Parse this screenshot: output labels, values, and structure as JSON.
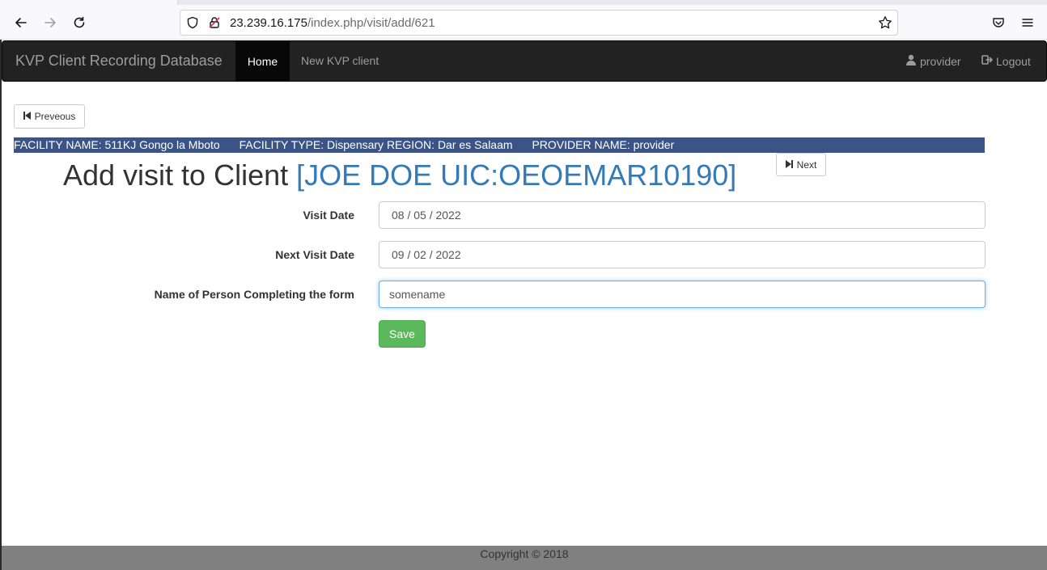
{
  "browser": {
    "url_host": "23.239.16.175",
    "url_path": "/index.php/visit/add/621"
  },
  "navbar": {
    "brand": "KVP Client Recording Database",
    "items": [
      {
        "label": "Home",
        "active": true
      },
      {
        "label": "New KVP client",
        "active": false
      }
    ],
    "user_label": "provider",
    "logout_label": "Logout"
  },
  "pager": {
    "previous_label": "Preveous",
    "next_label": "Next"
  },
  "facility": {
    "name": "FACILITY NAME: 511KJ Gongo la Mboto",
    "type_region": "FACILITY TYPE: Dispensary REGION: Dar es Salaam",
    "provider": "PROVIDER NAME: provider"
  },
  "title": {
    "prefix": "Add visit to Client",
    "client": "[JOE DOE UIC:OEOEMAR10190]"
  },
  "form": {
    "visit_date_label": "Visit Date",
    "visit_date_value": "08 / 05 / 2022",
    "next_visit_label": "Next Visit Date",
    "next_visit_value": "09 / 02 / 2022",
    "completer_label": "Name of Person Completing the form",
    "completer_value": "somename",
    "save_label": "Save"
  },
  "footer": {
    "copyright": "Copyright © 2018"
  },
  "colors": {
    "navbar_bg": "#222222",
    "facility_bar": "#3b5485",
    "client_link": "#337ab7",
    "save_green": "#5cb85c",
    "footer_bg": "#808080"
  }
}
